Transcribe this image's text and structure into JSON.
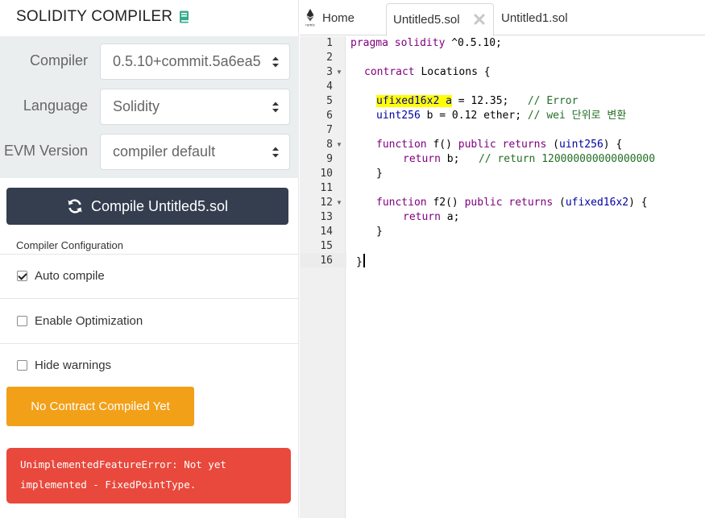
{
  "panel": {
    "title": "SOLIDITY COMPILER",
    "book_icon": "book-icon"
  },
  "settings": {
    "compiler_label": "Compiler",
    "compiler_value": "0.5.10+commit.5a6ea5",
    "language_label": "Language",
    "language_value": "Solidity",
    "evm_label": "EVM Version",
    "evm_value": "compiler default"
  },
  "compile_button": {
    "label": "Compile Untitled5.sol",
    "icon": "refresh-icon"
  },
  "config": {
    "section_label": "Compiler Configuration",
    "auto_compile": {
      "label": "Auto compile",
      "checked": true
    },
    "optimization": {
      "label": "Enable Optimization",
      "checked": false
    },
    "hide_warnings": {
      "label": "Hide warnings",
      "checked": false
    }
  },
  "status_button": {
    "label": "No Contract Compiled Yet",
    "color": "#f2a018"
  },
  "error": {
    "line1": "UnimplementedFeatureError: Not yet",
    "line2": "implemented - FixedPointType.",
    "color": "#e9483c"
  },
  "tabs": {
    "home": "Home",
    "home_logo_text": "remix",
    "active": "Untitled5.sol",
    "other": "Untitled1.sol"
  },
  "editor": {
    "line_numbers": [
      "1",
      "2",
      "3",
      "4",
      "5",
      "6",
      "7",
      "8",
      "9",
      "10",
      "11",
      "12",
      "13",
      "14",
      "15",
      "16"
    ],
    "lines": [
      [
        {
          "t": "pragma solidity ^0.5.10;",
          "c": "kw-mixed"
        }
      ],
      [],
      [],
      [],
      [],
      [],
      [],
      [],
      [],
      [],
      [],
      [],
      [],
      [],
      [],
      []
    ],
    "code": {
      "l1_kw": "pragma solidity",
      "l1_rest": " ^0.5.10;",
      "l3_kw": "contract",
      "l3_rest": " Locations {",
      "l5_hl": "ufixed16x2 a",
      "l5_rest": " = 12.35;   ",
      "l5_cm": "// Error",
      "l6_ty": "uint256",
      "l6_rest": " b = 0.12 ether; ",
      "l6_cm": "// wei 단위로 변환",
      "l8_kw": "function",
      "l8_mid": " f() ",
      "l8_kw2": "public returns",
      "l8_open": " (",
      "l8_ty": "uint256",
      "l8_close": ") {",
      "l9_kw": "return",
      "l9_rest": " b;   ",
      "l9_cm": "// return 120000000000000000",
      "l10": "}",
      "l12_kw": "function",
      "l12_mid": " f2() ",
      "l12_kw2": "public returns",
      "l12_open": " (",
      "l12_ty": "ufixed16x2",
      "l12_close": ") {",
      "l13_kw": "return",
      "l13_rest": " a;",
      "l14": "}",
      "l16": "}"
    }
  }
}
